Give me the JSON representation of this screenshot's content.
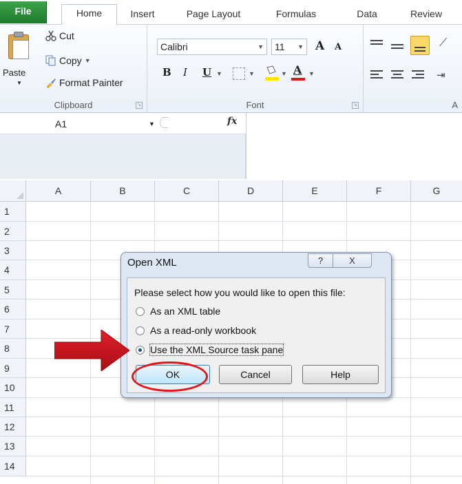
{
  "tabs": [
    "File",
    "Home",
    "Insert",
    "Page Layout",
    "Formulas",
    "Data",
    "Review"
  ],
  "clipboard": {
    "paste": "Paste",
    "cut": "Cut",
    "copy": "Copy",
    "format_painter": "Format Painter",
    "group_label": "Clipboard"
  },
  "font": {
    "name": "Calibri",
    "size": "11",
    "group_label": "Font",
    "bold": "B",
    "italic": "I",
    "underline": "U",
    "grow": "A",
    "shrink": "A",
    "color": "A"
  },
  "alignment": {
    "group_label": "A"
  },
  "formula_bar": {
    "cell_ref": "A1",
    "fx": "fx"
  },
  "grid": {
    "columns": [
      "A",
      "B",
      "C",
      "D",
      "E",
      "F",
      "G"
    ],
    "rows": [
      "1",
      "2",
      "3",
      "4",
      "5",
      "6",
      "7",
      "8",
      "9",
      "10",
      "11",
      "12",
      "13",
      "14"
    ]
  },
  "dialog": {
    "title": "Open XML",
    "help_glyph": "?",
    "close_glyph": "X",
    "prompt": "Please select how you would like to open this file:",
    "options": [
      "As an XML table",
      "As a read-only workbook",
      "Use the XML Source task pane"
    ],
    "selected_index": 2,
    "ok": "OK",
    "cancel": "Cancel",
    "help": "Help"
  },
  "colors": {
    "file_tab": "#2e7d32",
    "highlight": "#e3141c"
  }
}
